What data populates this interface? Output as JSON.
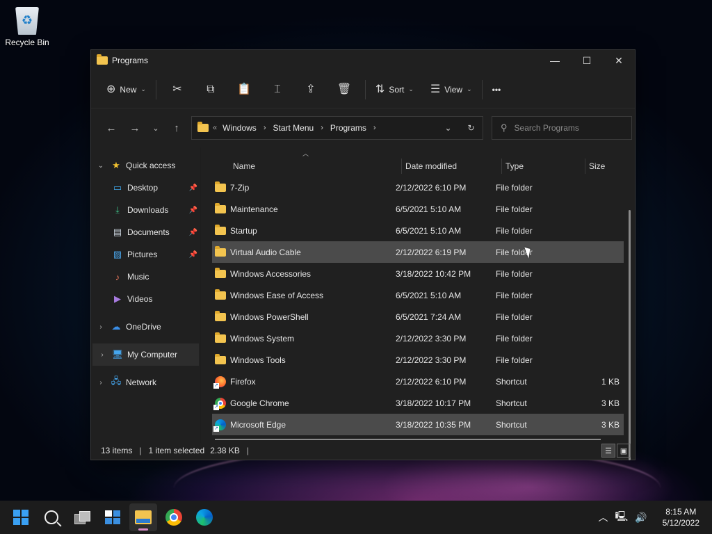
{
  "desktop": {
    "icons": [
      {
        "label": "Recycle Bin",
        "icon": "recycle-bin-icon"
      }
    ]
  },
  "window": {
    "title": "Programs",
    "controls": {
      "minimize": "—",
      "maximize": "☐",
      "close": "✕"
    }
  },
  "toolbar": {
    "new_label": "New",
    "sort_label": "Sort",
    "view_label": "View",
    "more_label": "•••",
    "icons": [
      "cut-icon",
      "copy-icon",
      "paste-icon",
      "rename-icon",
      "share-icon",
      "delete-icon"
    ]
  },
  "address_bar": {
    "overflow": "«",
    "crumbs": [
      "Windows",
      "Start Menu",
      "Programs"
    ],
    "separator": "›"
  },
  "search": {
    "placeholder": "Search Programs"
  },
  "nav_pane": {
    "quick_access": "Quick access",
    "pinned": [
      {
        "label": "Desktop",
        "icon": "desktop-icon",
        "pinned": true
      },
      {
        "label": "Downloads",
        "icon": "downloads-icon",
        "pinned": true
      },
      {
        "label": "Documents",
        "icon": "documents-icon",
        "pinned": true
      },
      {
        "label": "Pictures",
        "icon": "pictures-icon",
        "pinned": true
      },
      {
        "label": "Music",
        "icon": "music-icon",
        "pinned": false
      },
      {
        "label": "Videos",
        "icon": "videos-icon",
        "pinned": false
      }
    ],
    "onedrive": "OneDrive",
    "this_pc": "My Computer",
    "network": "Network"
  },
  "columns": {
    "name": "Name",
    "date": "Date modified",
    "type": "Type",
    "size": "Size"
  },
  "files": [
    {
      "name": "7-Zip",
      "date": "2/12/2022 6:10 PM",
      "type": "File folder",
      "size": "",
      "kind": "folder",
      "selected": false
    },
    {
      "name": "Maintenance",
      "date": "6/5/2021 5:10 AM",
      "type": "File folder",
      "size": "",
      "kind": "folder",
      "selected": false
    },
    {
      "name": "Startup",
      "date": "6/5/2021 5:10 AM",
      "type": "File folder",
      "size": "",
      "kind": "folder",
      "selected": false
    },
    {
      "name": "Virtual Audio Cable",
      "date": "2/12/2022 6:19 PM",
      "type": "File folder",
      "size": "",
      "kind": "folder",
      "selected": true
    },
    {
      "name": "Windows Accessories",
      "date": "3/18/2022 10:42 PM",
      "type": "File folder",
      "size": "",
      "kind": "folder",
      "selected": false
    },
    {
      "name": "Windows Ease of Access",
      "date": "6/5/2021 5:10 AM",
      "type": "File folder",
      "size": "",
      "kind": "folder",
      "selected": false
    },
    {
      "name": "Windows PowerShell",
      "date": "6/5/2021 7:24 AM",
      "type": "File folder",
      "size": "",
      "kind": "folder",
      "selected": false
    },
    {
      "name": "Windows System",
      "date": "2/12/2022 3:30 PM",
      "type": "File folder",
      "size": "",
      "kind": "folder",
      "selected": false
    },
    {
      "name": "Windows Tools",
      "date": "2/12/2022 3:30 PM",
      "type": "File folder",
      "size": "",
      "kind": "folder",
      "selected": false
    },
    {
      "name": "Firefox",
      "date": "2/12/2022 6:10 PM",
      "type": "Shortcut",
      "size": "1 KB",
      "kind": "firefox",
      "selected": false
    },
    {
      "name": "Google Chrome",
      "date": "3/18/2022 10:17 PM",
      "type": "Shortcut",
      "size": "3 KB",
      "kind": "chrome",
      "selected": false
    },
    {
      "name": "Microsoft Edge",
      "date": "3/18/2022 10:35 PM",
      "type": "Shortcut",
      "size": "3 KB",
      "kind": "edge",
      "selected": true
    }
  ],
  "status": {
    "items": "13 items",
    "selected": "1 item selected",
    "size": "2.38 KB"
  },
  "taskbar": {
    "apps": [
      "start-icon",
      "search-icon",
      "task-view-icon",
      "widgets-icon",
      "file-explorer-icon",
      "chrome-icon",
      "edge-icon"
    ],
    "active": "file-explorer-icon",
    "tray": [
      "chevron-up-icon",
      "network-icon",
      "volume-icon"
    ],
    "time": "8:15 AM",
    "date": "5/12/2022"
  },
  "colors": {
    "accent": "#3aa0f3",
    "selection": "#4b4b4b",
    "folder": "#f3c44f"
  }
}
